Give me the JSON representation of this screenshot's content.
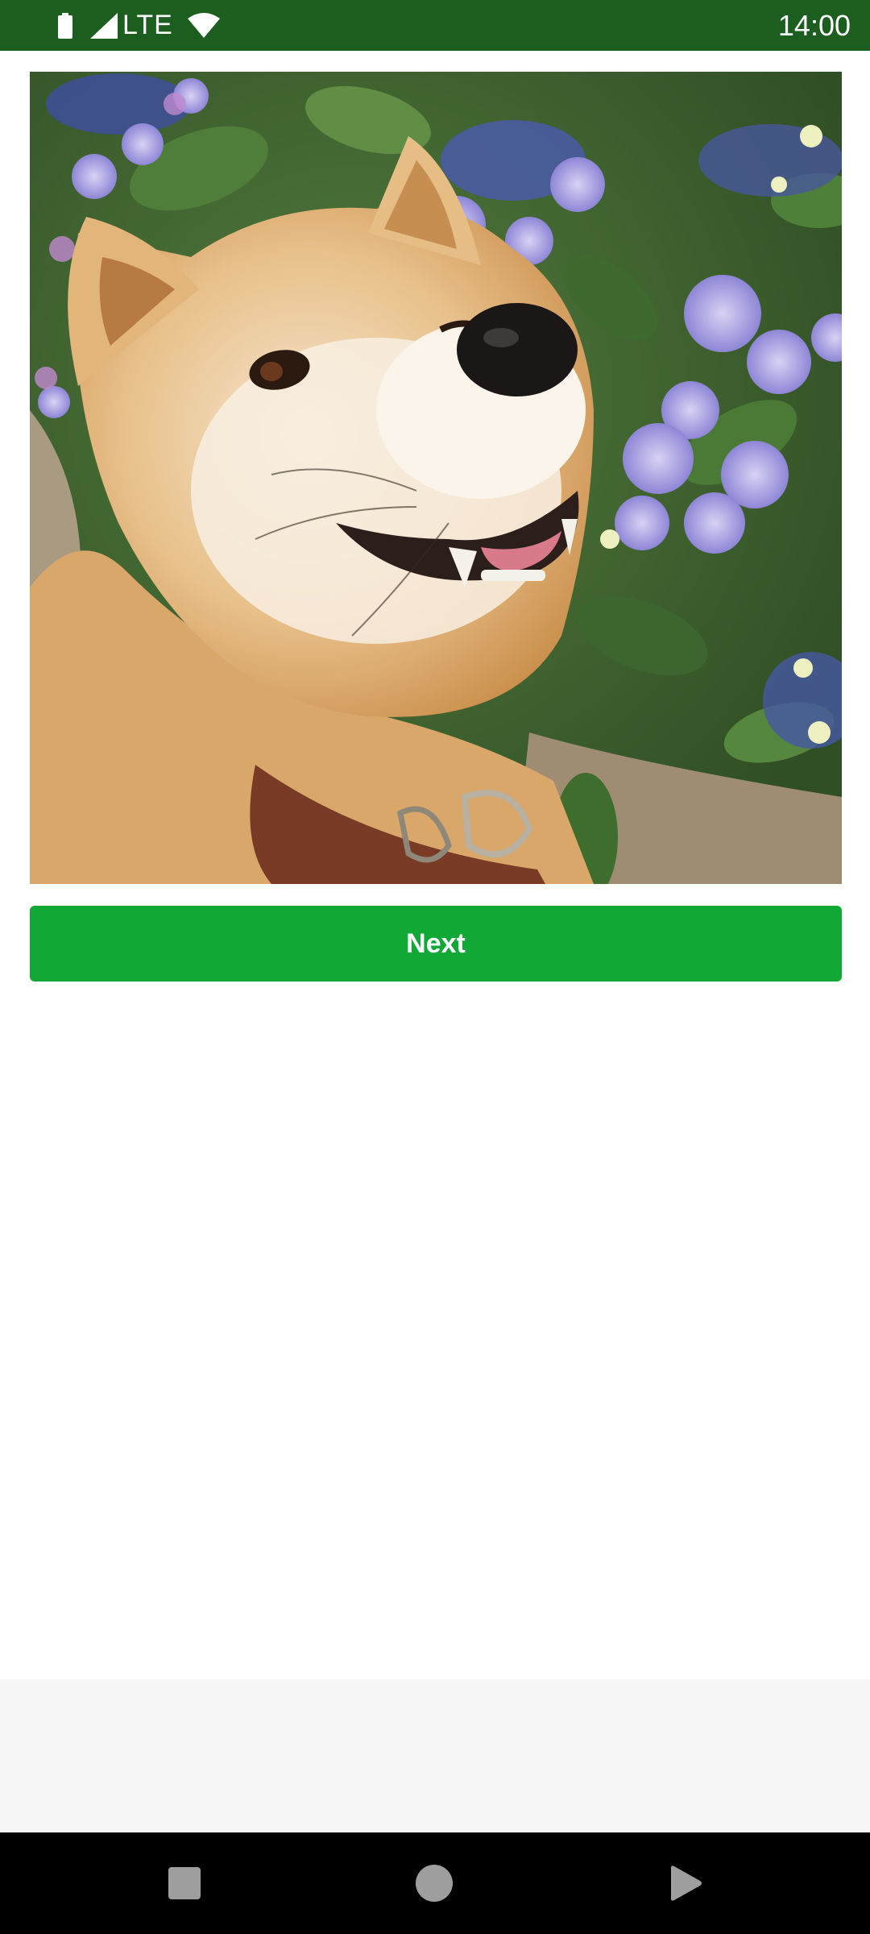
{
  "status_bar": {
    "network": "LTE",
    "time": "14:00",
    "icons": [
      "battery-icon",
      "signal-icon",
      "wifi-icon"
    ]
  },
  "photo": {
    "icon": "shiba-inu-photo"
  },
  "next_button": {
    "label": "Next"
  },
  "navigation": {
    "icons": [
      "recents-icon",
      "home-icon",
      "back-icon"
    ]
  },
  "colors": {
    "status_bar": "#1b5e20",
    "button": "#11a836",
    "bottom_panel": "#f7f7f7",
    "nav_bar": "#000000"
  }
}
